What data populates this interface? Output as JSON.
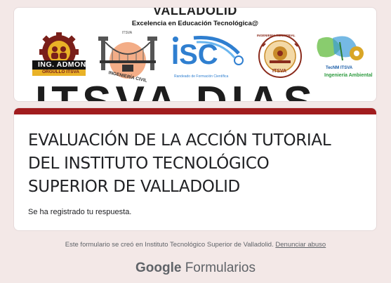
{
  "banner": {
    "title": "VALLADOLID",
    "subtitle": "Excelencia en Educación Tecnológica@",
    "background_text": "ITSVA DIAS",
    "logos": [
      {
        "name": "ing-admon-logo",
        "text": "ING. ADMON",
        "subtext": "ORGULLO ITSVA"
      },
      {
        "name": "ing-civil-logo",
        "text": "INGENIERÍA CIVIL",
        "subtext": "ITSVA"
      },
      {
        "name": "isc-logo",
        "text": "ISC",
        "subtext": "Randeado de Formación Científica"
      },
      {
        "name": "itsva-industrial-logo",
        "text": "ITSVA",
        "subtext": "INGENIERIA INDUSTRIAL"
      },
      {
        "name": "ing-ambiental-logo",
        "text": "Ingeniería Ambiental",
        "subtext": "TecNM ITSVA"
      }
    ]
  },
  "form": {
    "title": "EVALUACIÓN DE LA ACCIÓN TUTORIAL\nDEL INSTITUTO TECNOLÓGICO\nSUPERIOR DE        VALLADOLID",
    "response_message": "Se ha registrado tu respuesta."
  },
  "footer": {
    "text": "Este formulario se creó en Instituto Tecnológico Superior de Valladolid.",
    "report_link": "Denunciar abuso",
    "brand_google": "Google",
    "brand_product": "Formularios"
  },
  "colors": {
    "page_background": "#f3e8e7",
    "accent_bar": "#a11c1e",
    "text_primary": "#202124",
    "text_secondary": "#5f6368"
  }
}
